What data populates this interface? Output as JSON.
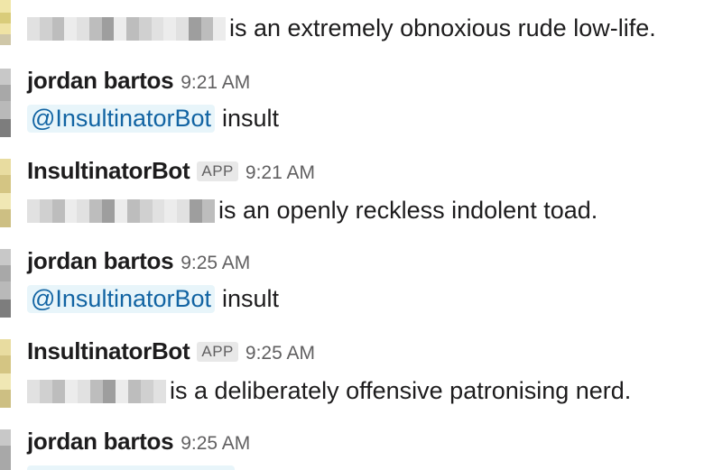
{
  "messages": [
    {
      "kind": "bot-body",
      "text": "is an extremely obnoxious rude low-life."
    },
    {
      "kind": "user",
      "author": "jordan bartos",
      "time": "9:21 AM",
      "mention": "@InsultinatorBot",
      "text": "insult"
    },
    {
      "kind": "bot",
      "author": "InsultinatorBot",
      "badge": "APP",
      "time": "9:21 AM",
      "text": "is an openly reckless indolent toad."
    },
    {
      "kind": "user",
      "author": "jordan bartos",
      "time": "9:25 AM",
      "mention": "@InsultinatorBot",
      "text": "insult"
    },
    {
      "kind": "bot",
      "author": "InsultinatorBot",
      "badge": "APP",
      "time": "9:25 AM",
      "text": "is a deliberately offensive patronising nerd."
    },
    {
      "kind": "user",
      "author": "jordan bartos",
      "time": "9:25 AM"
    }
  ],
  "colors": {
    "mention_text": "#1264a3",
    "mention_bg": "#e8f5fa",
    "timestamp": "#616061",
    "bot_avatar_strip": "#e6d79a",
    "user_avatar_strip": "#9a9a9a"
  }
}
